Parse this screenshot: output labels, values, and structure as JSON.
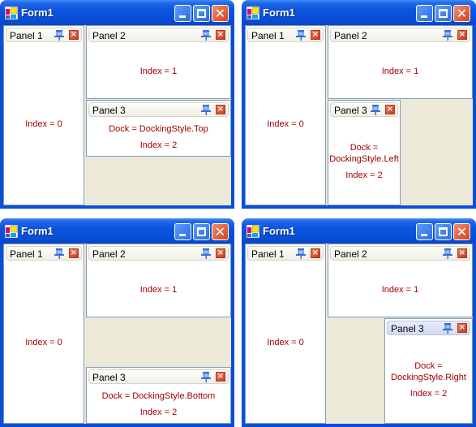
{
  "windows": [
    {
      "title": "Form1",
      "variant": "top",
      "panels": [
        {
          "title": "Panel 1",
          "lines": [
            "Index = 0"
          ]
        },
        {
          "title": "Panel 2",
          "lines": [
            "Index = 1"
          ]
        },
        {
          "title": "Panel 3",
          "lines": [
            "Dock = DockingStyle.Top",
            "Index = 2"
          ],
          "active": false
        }
      ]
    },
    {
      "title": "Form1",
      "variant": "left",
      "panels": [
        {
          "title": "Panel 1",
          "lines": [
            "Index = 0"
          ]
        },
        {
          "title": "Panel 2",
          "lines": [
            "Index = 1"
          ]
        },
        {
          "title": "Panel 3",
          "lines": [
            "Dock =",
            "DockingStyle.Left",
            "Index = 2"
          ],
          "active": false
        }
      ]
    },
    {
      "title": "Form1",
      "variant": "bottom",
      "panels": [
        {
          "title": "Panel 1",
          "lines": [
            "Index = 0"
          ]
        },
        {
          "title": "Panel 2",
          "lines": [
            "Index = 1"
          ]
        },
        {
          "title": "Panel 3",
          "lines": [
            "Dock = DockingStyle.Bottom",
            "Index = 2"
          ],
          "active": false
        }
      ]
    },
    {
      "title": "Form1",
      "variant": "right",
      "panels": [
        {
          "title": "Panel 1",
          "lines": [
            "Index = 0"
          ]
        },
        {
          "title": "Panel 2",
          "lines": [
            "Index = 1"
          ]
        },
        {
          "title": "Panel 3",
          "lines": [
            "Dock =",
            "DockingStyle.Right",
            "Index = 2"
          ],
          "active": true
        }
      ]
    }
  ],
  "icons": {
    "minimize": "minimize-icon",
    "maximize": "maximize-icon",
    "close": "close-icon",
    "pin": "pin-icon",
    "panel_close": "panel-close-icon",
    "panel_close_glyph": "×",
    "window_close_glyph": "✕"
  },
  "colors": {
    "titlebar": "#0a4fd8",
    "client_bg": "#ece9d8",
    "panel_border": "#7f9db9",
    "text_red": "#a00000",
    "active_header": "#d3daf4"
  }
}
